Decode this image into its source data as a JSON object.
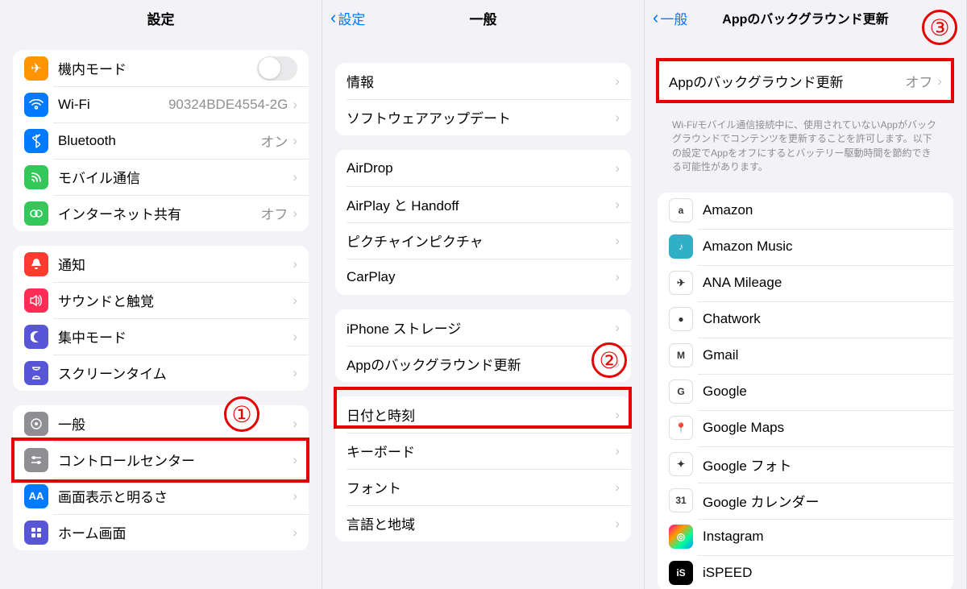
{
  "pane1": {
    "title": "設定",
    "annotation": "①",
    "group1": [
      {
        "icon": "airplane",
        "label": "機内モード",
        "control": "toggle"
      },
      {
        "icon": "wifi",
        "label": "Wi-Fi",
        "value": "90324BDE4554-2G"
      },
      {
        "icon": "bluetooth",
        "label": "Bluetooth",
        "value": "オン"
      },
      {
        "icon": "cellular",
        "label": "モバイル通信"
      },
      {
        "icon": "hotspot",
        "label": "インターネット共有",
        "value": "オフ"
      }
    ],
    "group2": [
      {
        "icon": "notifications",
        "label": "通知"
      },
      {
        "icon": "sounds",
        "label": "サウンドと触覚"
      },
      {
        "icon": "focus",
        "label": "集中モード"
      },
      {
        "icon": "screentime",
        "label": "スクリーンタイム"
      }
    ],
    "group3": [
      {
        "icon": "general",
        "label": "一般",
        "highlight": true
      },
      {
        "icon": "control",
        "label": "コントロールセンター"
      },
      {
        "icon": "display",
        "label": "画面表示と明るさ"
      },
      {
        "icon": "home",
        "label": "ホーム画面"
      }
    ]
  },
  "pane2": {
    "back": "設定",
    "title": "一般",
    "annotation": "②",
    "group1": [
      {
        "label": "情報"
      },
      {
        "label": "ソフトウェアアップデート"
      }
    ],
    "group2": [
      {
        "label": "AirDrop"
      },
      {
        "label": "AirPlay と Handoff"
      },
      {
        "label": "ピクチャインピクチャ"
      },
      {
        "label": "CarPlay"
      }
    ],
    "group3": [
      {
        "label": "iPhone ストレージ"
      },
      {
        "label": "Appのバックグラウンド更新",
        "highlight": true
      }
    ],
    "group4": [
      {
        "label": "日付と時刻"
      },
      {
        "label": "キーボード"
      },
      {
        "label": "フォント"
      },
      {
        "label": "言語と地域"
      }
    ]
  },
  "pane3": {
    "back": "一般",
    "title": "Appのバックグラウンド更新",
    "annotation": "③",
    "master": {
      "label": "Appのバックグラウンド更新",
      "value": "オフ"
    },
    "note": "Wi-Fi/モバイル通信接続中に、使用されていないAppがバックグラウンドでコンテンツを更新することを許可します。以下の設定でAppをオフにするとバッテリー駆動時間を節約できる可能性があります。",
    "apps": [
      {
        "name": "Amazon",
        "iconStyle": "bg-white",
        "glyph": "a"
      },
      {
        "name": "Amazon Music",
        "iconStyle": "bg-teal",
        "glyph": "♪"
      },
      {
        "name": "ANA Mileage",
        "iconStyle": "bg-white",
        "glyph": "✈"
      },
      {
        "name": "Chatwork",
        "iconStyle": "bg-white",
        "glyph": "●"
      },
      {
        "name": "Gmail",
        "iconStyle": "bg-white",
        "glyph": "M"
      },
      {
        "name": "Google",
        "iconStyle": "bg-white",
        "glyph": "G"
      },
      {
        "name": "Google Maps",
        "iconStyle": "bg-white",
        "glyph": "📍"
      },
      {
        "name": "Google フォト",
        "iconStyle": "bg-white",
        "glyph": "✦"
      },
      {
        "name": "Google カレンダー",
        "iconStyle": "bg-white",
        "glyph": "31"
      },
      {
        "name": "Instagram",
        "iconStyle": "bg-gradient",
        "glyph": "◎"
      },
      {
        "name": "iSPEED",
        "iconStyle": "bg-black",
        "glyph": "iS"
      }
    ]
  }
}
